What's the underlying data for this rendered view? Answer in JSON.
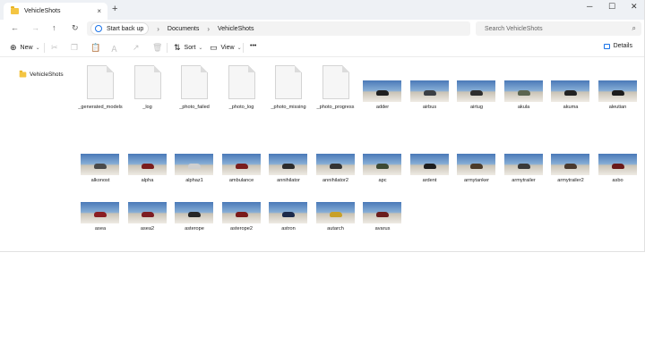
{
  "window": {
    "tab_title": "VehicleShots",
    "new_tab_symbol": "+",
    "tab_close_symbol": "×",
    "controls": {
      "minimize": "─",
      "maximize": "☐",
      "close": "✕"
    }
  },
  "nav": {
    "back": "←",
    "forward": "→",
    "up": "↑",
    "refresh": "↻"
  },
  "address": {
    "backup_label": "Start back up",
    "separator": "›",
    "crumbs": [
      "Documents",
      "VehicleShots"
    ]
  },
  "search": {
    "placeholder": "Search VehicleShots",
    "glyph": "⌕"
  },
  "toolbar": {
    "new_label": "New",
    "new_symbol": "⊕",
    "caret": "⌄",
    "cut_symbol": "✂",
    "copy_symbol": "❐",
    "paste_symbol": "📋",
    "rename_symbol": "Ａ",
    "share_symbol": "↗",
    "delete_symbol": "🗑",
    "sort_label": "Sort",
    "sort_symbol": "⇅",
    "view_label": "View",
    "view_symbol": "▭",
    "more_symbol": "•••",
    "details_label": "Details"
  },
  "sidebar": {
    "items": [
      {
        "label": "VehicleShots"
      }
    ]
  },
  "files": [
    {
      "name": "_generated_models",
      "kind": "doc"
    },
    {
      "name": "_log",
      "kind": "doc"
    },
    {
      "name": "_photo_failed",
      "kind": "doc"
    },
    {
      "name": "_photo_log",
      "kind": "doc"
    },
    {
      "name": "_photo_missing",
      "kind": "doc"
    },
    {
      "name": "_photo_progress",
      "kind": "doc"
    },
    {
      "name": "adder",
      "kind": "image",
      "car": "#1f1f1f"
    },
    {
      "name": "airbus",
      "kind": "image",
      "car": "#3b3f44"
    },
    {
      "name": "airtug",
      "kind": "image",
      "car": "#2e2e2e"
    },
    {
      "name": "akula",
      "kind": "image",
      "car": "#5b6550"
    },
    {
      "name": "akuma",
      "kind": "image",
      "car": "#222222"
    },
    {
      "name": "aleutian",
      "kind": "image",
      "car": "#1c1c1c"
    },
    {
      "name": "alkonost",
      "kind": "image",
      "car": "#4a4a4a"
    },
    {
      "name": "alpha",
      "kind": "image",
      "car": "#7a1d1d"
    },
    {
      "name": "alphaz1",
      "kind": "image",
      "car": "#cfcfcf"
    },
    {
      "name": "ambulance",
      "kind": "image",
      "car": "#7a1e1e"
    },
    {
      "name": "annihilator",
      "kind": "image",
      "car": "#2c2c2c"
    },
    {
      "name": "annihilator2",
      "kind": "image",
      "car": "#333333"
    },
    {
      "name": "apc",
      "kind": "image",
      "car": "#3d4a34"
    },
    {
      "name": "ardent",
      "kind": "image",
      "car": "#1e1e1e"
    },
    {
      "name": "armytanker",
      "kind": "image",
      "car": "#4b3b2a"
    },
    {
      "name": "armytrailer",
      "kind": "image",
      "car": "#3a3a3a"
    },
    {
      "name": "armytrailer2",
      "kind": "image",
      "car": "#4a3a2e"
    },
    {
      "name": "asbo",
      "kind": "image",
      "car": "#6a1a1a"
    },
    {
      "name": "asea",
      "kind": "image",
      "car": "#8a1e22"
    },
    {
      "name": "asea2",
      "kind": "image",
      "car": "#7d1d22"
    },
    {
      "name": "asterope",
      "kind": "image",
      "car": "#262626"
    },
    {
      "name": "asterope2",
      "kind": "image",
      "car": "#7a1a1a"
    },
    {
      "name": "astron",
      "kind": "image",
      "car": "#1c2a4a"
    },
    {
      "name": "autarch",
      "kind": "image",
      "car": "#c8a028"
    },
    {
      "name": "avarus",
      "kind": "image",
      "car": "#6a1e1e"
    }
  ]
}
